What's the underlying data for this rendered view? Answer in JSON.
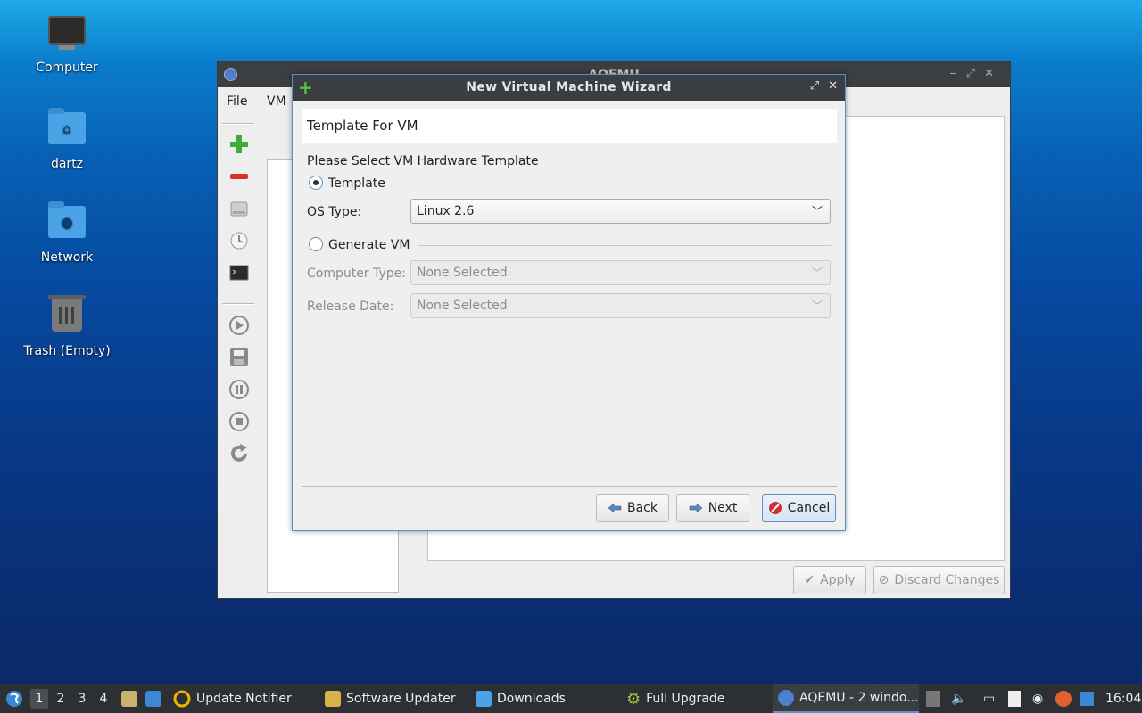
{
  "desktop": {
    "icons": [
      {
        "label": "Computer"
      },
      {
        "label": "dartz"
      },
      {
        "label": "Network"
      },
      {
        "label": "Trash (Empty)"
      }
    ]
  },
  "main_window": {
    "title": "AQEMU",
    "menu": [
      "File",
      "VM"
    ],
    "apply_label": "Apply",
    "discard_label": "Discard Changes"
  },
  "wizard": {
    "title": "New Virtual Machine Wizard",
    "header": "Template For VM",
    "prompt": "Please Select VM Hardware Template",
    "template_label": "Template",
    "os_type_label": "OS Type:",
    "os_type_value": "Linux 2.6",
    "generate_label": "Generate VM",
    "computer_type_label": "Computer Type:",
    "computer_type_value": "None Selected",
    "release_date_label": "Release Date:",
    "release_date_value": "None Selected",
    "back_label": "Back",
    "next_label": "Next",
    "cancel_label": "Cancel"
  },
  "taskbar": {
    "workspaces": [
      "1",
      "2",
      "3",
      "4"
    ],
    "tasks": [
      {
        "label": "Update Notifier"
      },
      {
        "label": "Software Updater"
      },
      {
        "label": "Downloads"
      },
      {
        "label": "Full Upgrade"
      },
      {
        "label": "AQEMU - 2 windo..."
      }
    ],
    "clock": "16:04"
  }
}
